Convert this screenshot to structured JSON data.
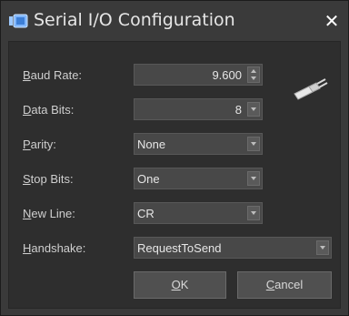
{
  "window": {
    "title": "Serial I/O Configuration",
    "icon": "serial-port-icon",
    "close_icon": "close-icon"
  },
  "fields": {
    "baud_rate": {
      "label_prefix": "",
      "label_accel": "B",
      "label_rest": "aud Rate:",
      "value": "9.600"
    },
    "data_bits": {
      "label_prefix": "",
      "label_accel": "D",
      "label_rest": "ata Bits:",
      "value": "8"
    },
    "parity": {
      "label_prefix": "",
      "label_accel": "P",
      "label_rest": "arity:",
      "value": "None"
    },
    "stop_bits": {
      "label_prefix": "",
      "label_accel": "S",
      "label_rest": "top Bits:",
      "value": "One"
    },
    "new_line": {
      "label_prefix": "",
      "label_accel": "N",
      "label_rest": "ew Line:",
      "value": "CR"
    },
    "handshake": {
      "label_prefix": "",
      "label_accel": "H",
      "label_rest": "andshake:",
      "value": "RequestToSend"
    }
  },
  "buttons": {
    "ok": {
      "accel": "O",
      "rest": "K"
    },
    "cancel": {
      "accel": "C",
      "rest": "ancel"
    }
  },
  "decor": {
    "plug_icon": "usb-plug-icon"
  },
  "colors": {
    "background": "#2e2e2e",
    "field": "#484848",
    "text": "#e6e6e6"
  }
}
